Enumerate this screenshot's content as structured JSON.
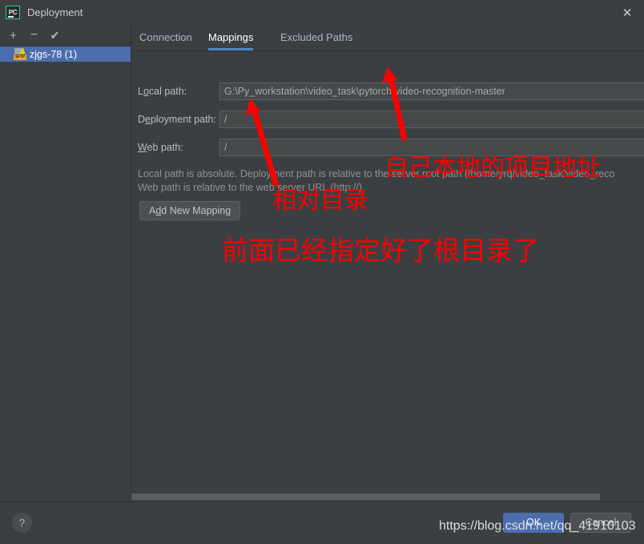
{
  "window": {
    "title": "Deployment",
    "logo_text": "PC",
    "close_icon": "✕"
  },
  "left_toolbar": {
    "add_label": "+",
    "remove_label": "−",
    "confirm_label": "✔"
  },
  "server_list": {
    "items": [
      {
        "name": "zjgs-78 (1)",
        "icon": "sftp-server-icon",
        "badge": "SFTP",
        "selected": true
      }
    ]
  },
  "tabs": [
    {
      "label": "Connection",
      "active": false
    },
    {
      "label": "Mappings",
      "active": true
    },
    {
      "label": "Excluded Paths",
      "active": false
    }
  ],
  "form": {
    "local_path_label_pre": "L",
    "local_path_label_mnemonic": "o",
    "local_path_label_post": "cal path:",
    "local_path_value": "G:\\Py_workstation\\video_task\\pytorch-video-recognition-master",
    "deployment_path_label_pre": "D",
    "deployment_path_label_mnemonic": "e",
    "deployment_path_label_post": "ployment path:",
    "deployment_path_value": "/",
    "web_path_label_pre": "",
    "web_path_label_mnemonic": "W",
    "web_path_label_post": "eb path:",
    "web_path_value": "/",
    "hint_line1": "Local path is absolute. Deployment path is relative to the server root path (/home/yrq/video_task/video_reco",
    "hint_line2": "Web path is relative to the web server URL (http://).",
    "add_mapping_pre": "A",
    "add_mapping_mnemonic": "d",
    "add_mapping_post": "d New Mapping"
  },
  "bottom": {
    "help_label": "?",
    "ok_label": "OK",
    "cancel_label": "Cancel"
  },
  "annotations": {
    "local_note": "自己本地的项目地址",
    "relative_note": "相对目录",
    "root_note": "前面已经指定好了根目录了"
  },
  "watermark": {
    "url": "https://blog.csdn.net/qq_41910103"
  },
  "colors": {
    "background": "#3c3f41",
    "selection": "#4b6eaf",
    "accent_tab": "#4a88c7",
    "annotation": "#ff0000",
    "logo_border": "#21d789"
  }
}
